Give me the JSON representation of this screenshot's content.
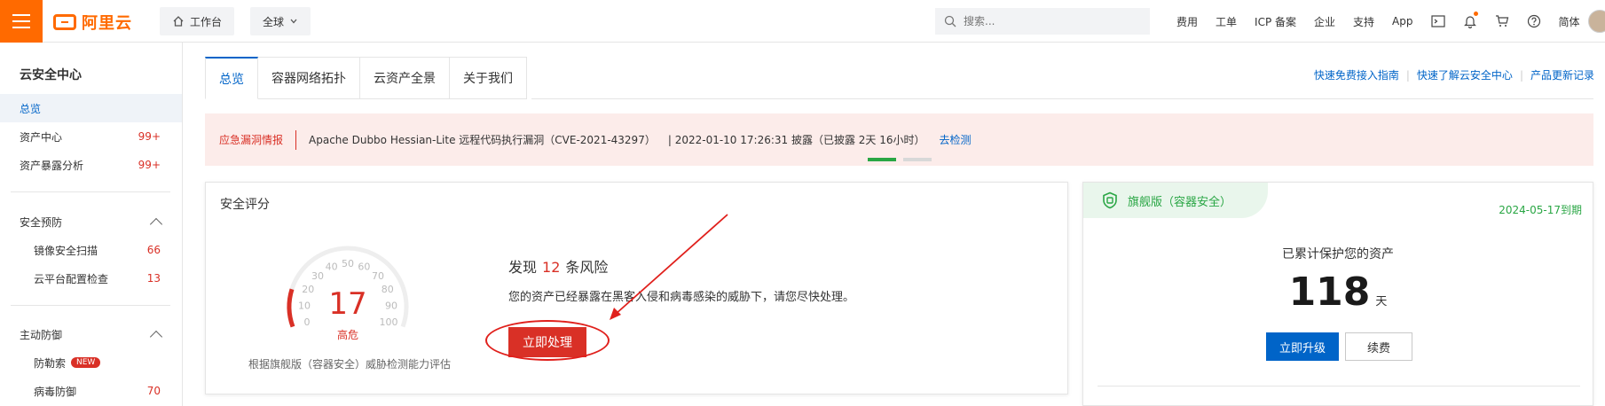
{
  "topbar": {
    "logo_text": "阿里云",
    "workbench": "工作台",
    "region": "全球",
    "search_placeholder": "搜索...",
    "links": [
      "费用",
      "工单",
      "ICP 备案",
      "企业",
      "支持",
      "App"
    ],
    "lang": "简体"
  },
  "sidebar": {
    "title": "云安全中心",
    "items": [
      {
        "label": "总览",
        "count": ""
      },
      {
        "label": "资产中心",
        "count": "99+"
      },
      {
        "label": "资产暴露分析",
        "count": "99+"
      }
    ],
    "group1": {
      "title": "安全预防",
      "items": [
        {
          "label": "镜像安全扫描",
          "count": "66"
        },
        {
          "label": "云平台配置检查",
          "count": "13"
        }
      ]
    },
    "group2": {
      "title": "主动防御",
      "items": [
        {
          "label": "防勒索",
          "badge": "NEW"
        },
        {
          "label": "病毒防御",
          "count": "70"
        }
      ]
    }
  },
  "tabs": [
    "总览",
    "容器网络拓扑",
    "云资产全景",
    "关于我们"
  ],
  "quick_links": [
    "快速免费接入指南",
    "快速了解云安全中心",
    "产品更新记录"
  ],
  "alert": {
    "type": "应急漏洞情报",
    "text": "Apache Dubbo Hessian-Lite 远程代码执行漏洞（CVE-2021-43297）",
    "date": "| 2022-01-10 17:26:31 披露（已披露 2天 16小时）",
    "link": "去检测"
  },
  "score_card": {
    "title": "安全评分",
    "score": "17",
    "level": "高危",
    "gauge_ticks": [
      "0",
      "10",
      "20",
      "30",
      "40",
      "50",
      "60",
      "70",
      "80",
      "90",
      "100"
    ],
    "gauge_value": 17,
    "note": "根据旗舰版（容器安全）威胁检测能力评估",
    "risk_prefix": "发现",
    "risk_count": "12",
    "risk_suffix": "条风险",
    "desc": "您的资产已经暴露在黑客入侵和病毒感染的威胁下，请您尽快处理。",
    "action": "立即处理"
  },
  "flag_card": {
    "name": "旗舰版（容器安全）",
    "expiry": "2024-05-17到期",
    "protect_label": "已累计保护您的资产",
    "days": "118",
    "unit": "天",
    "upgrade": "立即升级",
    "renew": "续费"
  },
  "colors": {
    "brand": "#ff6a00",
    "link": "#0064c8",
    "danger": "#d93026",
    "success": "#29a644"
  }
}
